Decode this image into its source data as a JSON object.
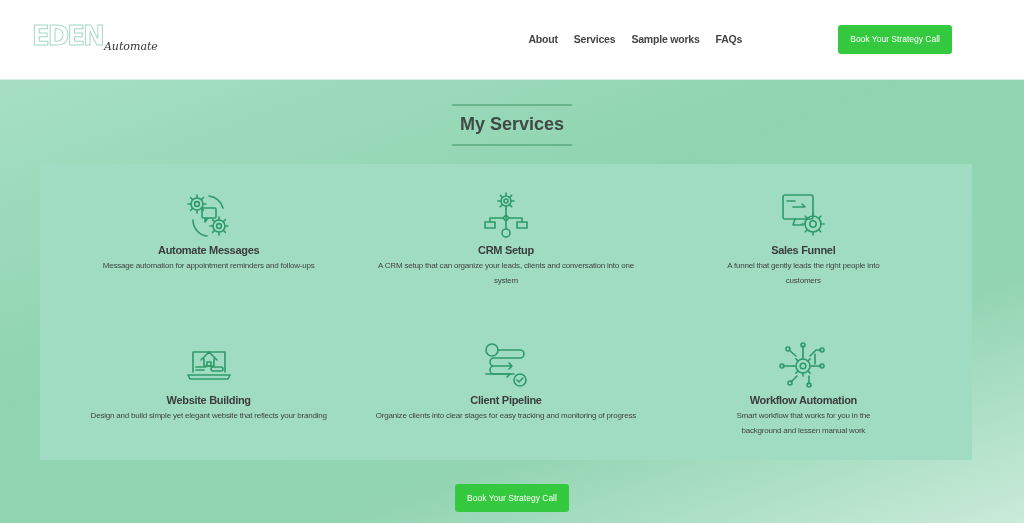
{
  "header": {
    "logo": {
      "mark": "EDEN",
      "script": "Automate"
    },
    "nav": [
      {
        "label": "About"
      },
      {
        "label": "Services"
      },
      {
        "label": "Sample works"
      },
      {
        "label": "FAQs"
      }
    ],
    "cta": "Book Your Strategy Call"
  },
  "section": {
    "title": "My Services",
    "services": [
      {
        "title": "Automate Messages",
        "description": "Message automation for appointment reminders and follow-ups"
      },
      {
        "title": "CRM Setup",
        "description": "A CRM setup that can organize your leads, clients and conversation into one system"
      },
      {
        "title": "Sales Funnel",
        "description": "A funnel that gently leads the right people into customers"
      },
      {
        "title": "Website Building",
        "description": "Design and build simple yet elegant website that reflects your branding"
      },
      {
        "title": "Client Pipeline",
        "description": "Organize clients into clear stages for easy tracking and monitoring of progress"
      },
      {
        "title": "Workflow Automation",
        "description": "Smart workflow that works for you in the background and lessen manual work"
      }
    ],
    "cta": "Book Your Strategy Call"
  }
}
